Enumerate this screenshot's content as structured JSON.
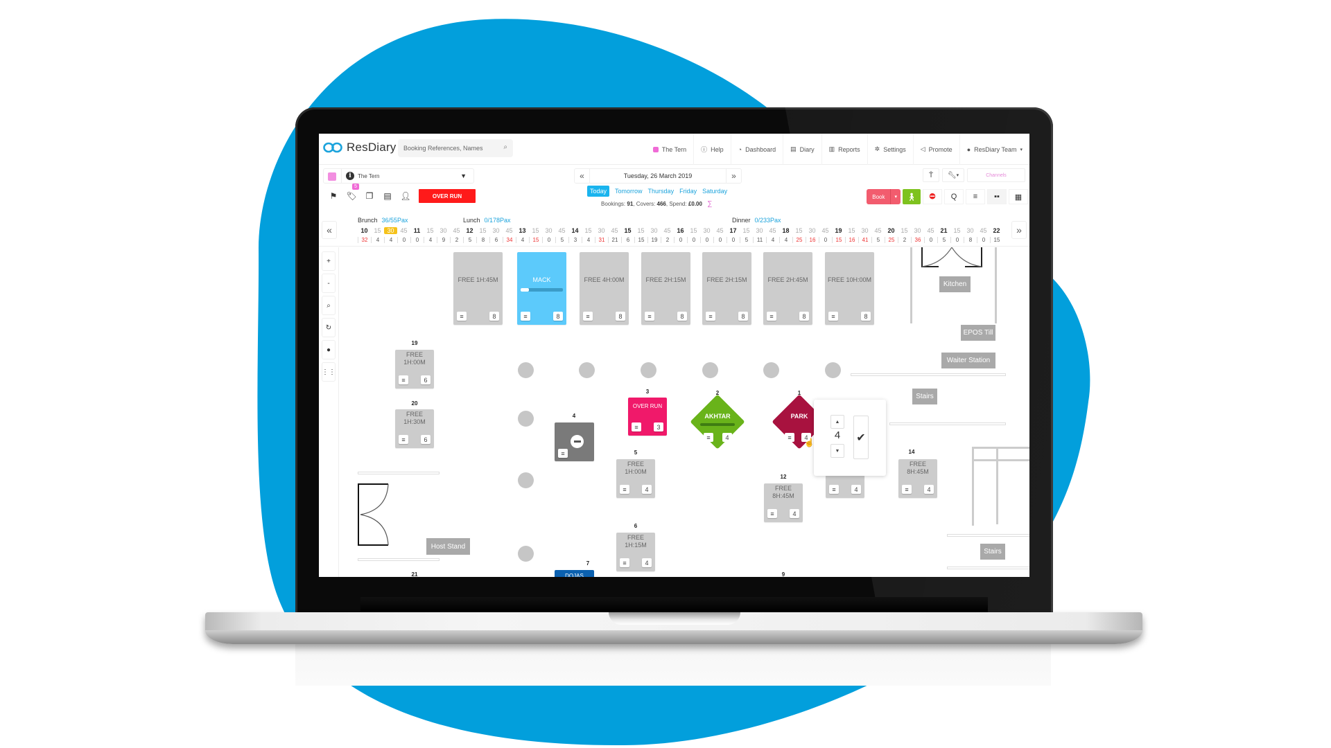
{
  "colors": {
    "blob": "#029fdc",
    "accent": "#1ab4ee",
    "overrun": "#ff1a1a",
    "venue_pink": "#f28ee0",
    "book": "#f25c6e",
    "walkin": "#7ec21e",
    "mack_table": "#5ccafb",
    "overrun_table": "#f0196a",
    "akhtar_table": "#69b31a",
    "park_table": "#a8123f",
    "blocked_table": "#7a7a7a",
    "booked_blue": "#0b61b0"
  },
  "header": {
    "logo": "ResDiary",
    "search_placeholder": "Booking References, Names",
    "nav": [
      {
        "icon": "venue-dot-icon",
        "label": "The Tern"
      },
      {
        "icon": "help-icon",
        "label": "Help"
      },
      {
        "icon": "dashboard-icon",
        "label": "Dashboard"
      },
      {
        "icon": "diary-icon",
        "label": "Diary"
      },
      {
        "icon": "reports-icon",
        "label": "Reports"
      },
      {
        "icon": "settings-icon",
        "label": "Settings"
      },
      {
        "icon": "promote-icon",
        "label": "Promote"
      },
      {
        "icon": "user-icon",
        "label": "ResDiary Team"
      }
    ]
  },
  "toolbar": {
    "venue": "The Tern",
    "tag_badge": "5",
    "overrun_label": "OVER RUN",
    "date": "Tuesday, 26 March 2019",
    "day_tabs": [
      "Today",
      "Tomorrow",
      "Thursday",
      "Friday",
      "Saturday"
    ],
    "active_day": "Today",
    "stats": {
      "bookings_label": "Bookings:",
      "bookings": "91",
      "covers_label": "Covers:",
      "covers": "466",
      "spend_label": "Spend:",
      "spend": "£0.00"
    },
    "channels_label": "Channels",
    "book_label": "Book",
    "q_label": "Q"
  },
  "timeline": {
    "periods": [
      {
        "name": "Brunch",
        "pax": "36/55Pax"
      },
      {
        "name": "Lunch",
        "pax": "0/178Pax"
      },
      {
        "name": "Dinner",
        "pax": "0/233Pax"
      }
    ],
    "slots": [
      "10",
      "15",
      "30",
      "45",
      "11",
      "15",
      "30",
      "45",
      "12",
      "15",
      "30",
      "45",
      "13",
      "15",
      "30",
      "45",
      "14",
      "15",
      "30",
      "45",
      "15",
      "15",
      "30",
      "45",
      "16",
      "15",
      "30",
      "45",
      "17",
      "15",
      "30",
      "45",
      "18",
      "15",
      "30",
      "45",
      "19",
      "15",
      "30",
      "45",
      "20",
      "15",
      "30",
      "45",
      "21",
      "15",
      "30",
      "45",
      "22"
    ],
    "current_slot_index": 2,
    "counts": [
      "32",
      "4",
      "4",
      "0",
      "0",
      "4",
      "9",
      "2",
      "5",
      "8",
      "6",
      "34",
      "4",
      "15",
      "0",
      "5",
      "3",
      "4",
      "31",
      "21",
      "6",
      "15",
      "19",
      "2",
      "0",
      "0",
      "0",
      "0",
      "0",
      "5",
      "11",
      "4",
      "4",
      "25",
      "16",
      "0",
      "15",
      "16",
      "41",
      "5",
      "25",
      "2",
      "36",
      "0",
      "5",
      "0",
      "8",
      "0",
      "15"
    ],
    "red_count_indices": [
      0,
      11,
      13,
      18,
      33,
      34,
      36,
      37,
      38,
      40,
      42
    ]
  },
  "side_controls": [
    "zoom-in",
    "zoom-out",
    "search",
    "rotate",
    "guest",
    "grid"
  ],
  "side_labels": [
    "+",
    "-",
    "⌕",
    "↻",
    "●",
    "⋮⋮"
  ],
  "floor": {
    "top_tables": [
      {
        "label": "FREE 1H:45M",
        "covers": "8"
      },
      {
        "label": "MACK",
        "covers": "8",
        "occupied": true
      },
      {
        "label": "FREE 4H:00M",
        "covers": "8"
      },
      {
        "label": "FREE 2H:15M",
        "covers": "8"
      },
      {
        "label": "FREE 2H:15M",
        "covers": "8"
      },
      {
        "label": "FREE 2H:45M",
        "covers": "8"
      },
      {
        "label": "FREE 10H:00M",
        "covers": "8"
      }
    ],
    "tables": {
      "t19": {
        "num": "19",
        "label1": "FREE",
        "label2": "1H:00M",
        "covers": "6"
      },
      "t20": {
        "num": "20",
        "label1": "FREE",
        "label2": "1H:30M",
        "covers": "6"
      },
      "t4": {
        "num": "4"
      },
      "t3": {
        "num": "3",
        "label": "OVER RUN",
        "covers": "3"
      },
      "t2": {
        "num": "2",
        "label": "AKHTAR",
        "covers": "4"
      },
      "t1": {
        "num": "1",
        "label": "PARK",
        "covers": "4"
      },
      "t5": {
        "num": "5",
        "label1": "FREE",
        "label2": "1H:00M",
        "covers": "4"
      },
      "t12": {
        "num": "12",
        "label1": "FREE",
        "label2": "8H:45M",
        "covers": "4"
      },
      "t13": {
        "covers": "4"
      },
      "t14": {
        "num": "14",
        "label1": "FREE",
        "label2": "8H:45M",
        "covers": "4"
      },
      "t6": {
        "num": "6",
        "label1": "FREE",
        "label2": "1H:15M",
        "covers": "4"
      },
      "t7": {
        "num": "7",
        "label": "DOJAS"
      },
      "t21": {
        "num": "21"
      },
      "t9": {
        "num": "9"
      }
    },
    "areas": {
      "kitchen": "Kitchen",
      "epos": "EPOS Till",
      "waiter": "Waiter Station",
      "stairs1": "Stairs",
      "stairs2": "Stairs",
      "host": "Host Stand"
    },
    "cover_popup": {
      "value": "4"
    }
  }
}
